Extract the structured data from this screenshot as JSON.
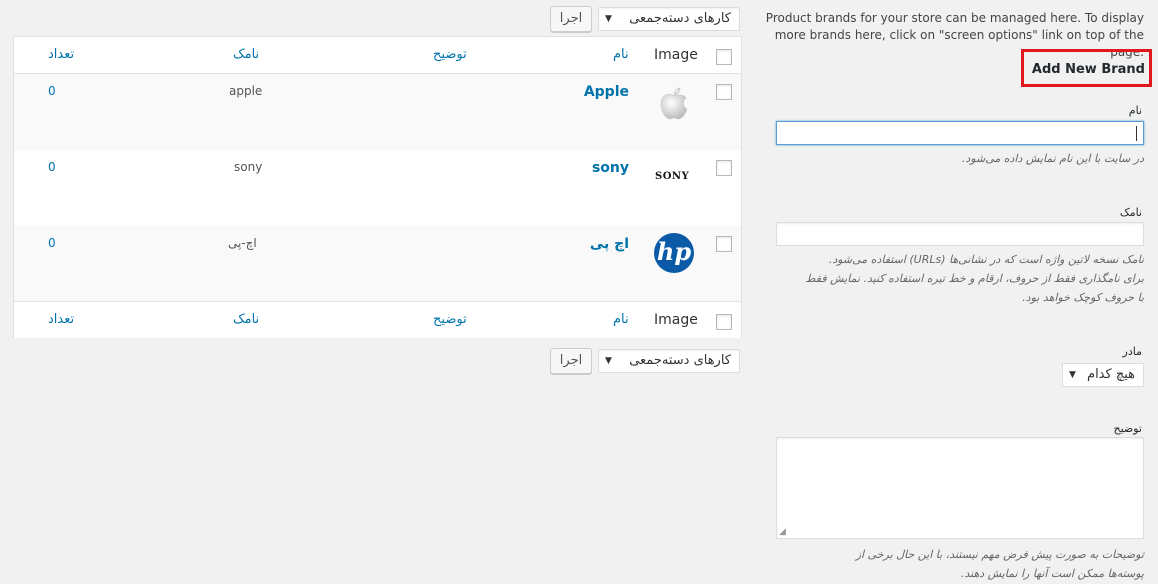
{
  "bulk": {
    "select_label": "کارهای دسته‌جمعی",
    "apply_label": "اجرا"
  },
  "table": {
    "columns": {
      "image": "Image",
      "name": "نام",
      "description": "توضیح",
      "slug": "نامک",
      "count": "تعداد"
    },
    "rows": [
      {
        "name": "Apple",
        "slug": "apple",
        "count": "0",
        "logo": "apple-logo-icon",
        "logo_text": ""
      },
      {
        "name": "sony",
        "slug": "sony",
        "count": "0",
        "logo": "sony-logo-icon",
        "logo_text": "SONY"
      },
      {
        "name": "اچ پی",
        "slug": "اچ-پی",
        "count": "0",
        "logo": "hp-logo-icon",
        "logo_text": "hp"
      }
    ]
  },
  "form": {
    "intro_line1": "Product brands for your store can be managed here. To display",
    "intro_line2": "more brands here, click on \"screen options\" link on top of the page.",
    "heading": "Add New Brand",
    "name_label": "نام",
    "name_value": "",
    "name_help": "در سایت با این نام نمایش داده می‌شود.",
    "slug_label": "نامک",
    "slug_value": "",
    "slug_help_1": "نامک نسخه لاتین واژه است که در نشانی‌ها (URLs) استفاده می‌شود.",
    "slug_help_2": "برای نامگذاری فقط از حروف، ارقام و خط تیره استفاده کنید. نمایش فقط",
    "slug_help_3": "با حروف کوچک خواهد بود.",
    "parent_label": "مادر",
    "parent_value": "هیچ کدام",
    "desc_label": "توضیح",
    "desc_help_1": "توضیحات به صورت پیش فرض مهم نیستند، با این حال برخی از",
    "desc_help_2": "پوسته‌ها ممکن است آنها را نمایش دهند."
  },
  "colors": {
    "link": "#0073aa",
    "highlight_box": "#e0191f",
    "hp_blue": "#0a5aa8"
  }
}
